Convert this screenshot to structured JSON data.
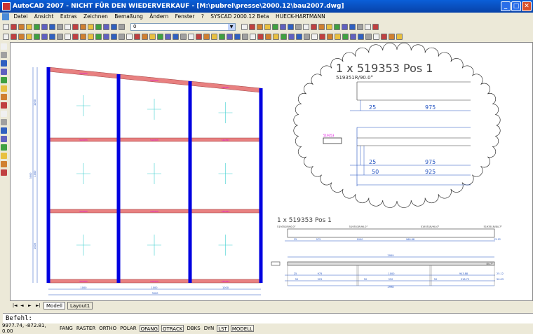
{
  "window": {
    "title": "AutoCAD 2007 - NICHT FÜR DEN WIEDERVERKAUF - [M:\\pubrel\\presse\\2000.12\\bau2007.dwg]",
    "min": "_",
    "max": "□",
    "close": "✕"
  },
  "menu": [
    "Datei",
    "Ansicht",
    "Extras",
    "Zeichnen",
    "Bemaßung",
    "Ändern",
    "Fenster",
    "?",
    "SYSCAD 2000.12 Beta",
    "HUECK-HARTMANN"
  ],
  "layer": {
    "value": "0"
  },
  "tabs": {
    "model": "Modell",
    "layout": "Layout1",
    "nav": [
      "|◄",
      "◄",
      "►",
      "►|"
    ]
  },
  "command": {
    "prompt": "Befehl:"
  },
  "status": {
    "coords": "9977.74, -872.81, 0.00",
    "buttons": [
      {
        "label": "FANG",
        "on": false
      },
      {
        "label": "RASTER",
        "on": false
      },
      {
        "label": "ORTHO",
        "on": false
      },
      {
        "label": "POLAR",
        "on": false
      },
      {
        "label": "OFANG",
        "on": true
      },
      {
        "label": "OTRACK",
        "on": true
      },
      {
        "label": "DBKS",
        "on": false
      },
      {
        "label": "DYN",
        "on": false
      },
      {
        "label": "LST",
        "on": true
      },
      {
        "label": "MODELL",
        "on": true
      }
    ]
  },
  "drawing": {
    "frame": {
      "widths": [
        "1000",
        "1000",
        "1000"
      ],
      "total_width": "3000",
      "heights": [
        "1000",
        "1000",
        "1000"
      ],
      "total_height": "3000",
      "beam_label": "519353",
      "post_label": "519351"
    },
    "cloud": {
      "title": "1 x 519353 Pos 1",
      "profile": "519351R/90.0°",
      "tag": "519353",
      "dims_top": [
        "25",
        "975"
      ],
      "dims_mid": [
        "25",
        "975"
      ],
      "dims_low": [
        "50",
        "925"
      ]
    },
    "detail": {
      "title": "1 x 519353 Pos 1",
      "profiles": [
        "519351R/90.0°",
        "519351R/90.0°",
        "519351R/90.0°",
        "519351R/84.7°"
      ],
      "row1": [
        "25",
        "975",
        "1000",
        "968.88",
        "25.12"
      ],
      "overall": "2959",
      "angle": "84.7°",
      "row2": [
        "25",
        "975",
        "1000",
        "943.88",
        "25.12"
      ],
      "row3": [
        "50",
        "925",
        "50",
        "950",
        "50",
        "918.75",
        "50.03"
      ],
      "total": "2998"
    }
  },
  "colors": {
    "post": "#0000e0",
    "beam": "#e88080",
    "dim": "#2050c0",
    "label": "#e000e0",
    "cross": "#40d0d0"
  }
}
